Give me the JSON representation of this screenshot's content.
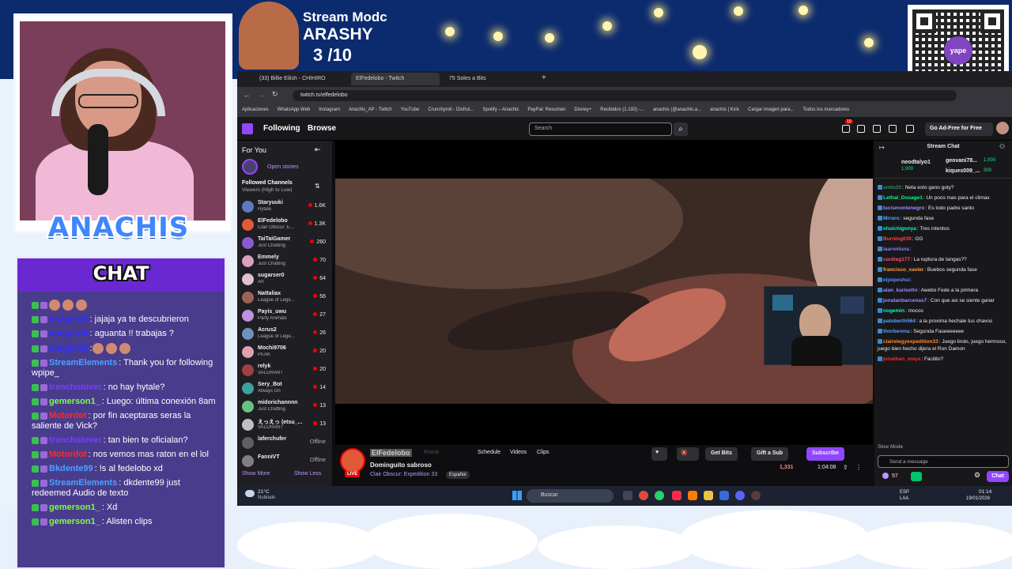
{
  "overlay": {
    "title": "Stream Modc",
    "name": "ARASHY",
    "count": "3  /10",
    "brand": "ANACHIS",
    "chat_header": "CHAT",
    "qr_logo": "yape"
  },
  "overlay_chat": [
    {
      "user": "",
      "text": "",
      "user_color": "#ffffff",
      "emotes": 3
    },
    {
      "user": "dangerdk",
      "text": ": jajaja ya te descubrieron",
      "user_color": "#2e2eff"
    },
    {
      "user": "dangerdk",
      "text": ": aguanta !! trabajas ?",
      "user_color": "#2e2eff"
    },
    {
      "user": "dangerdk",
      "text": ":",
      "user_color": "#2e2eff",
      "emotes": 3
    },
    {
      "user": "StreamElements",
      "text": ": Thank you for following wpipe_",
      "user_color": "#4aa3ff"
    },
    {
      "user": "trencholover",
      "text": ": no hay hytale?",
      "user_color": "#7a3cff"
    },
    {
      "user": "gemerson1_",
      "text": ": Luego: última conexión 8am",
      "user_color": "#7dff4a"
    },
    {
      "user": "Motordot",
      "text": ": por fin aceptaras seras la saliente de Vick?",
      "user_color": "#ff2a2a"
    },
    {
      "user": "trencholover",
      "text": ": tan bien te oficialan?",
      "user_color": "#7a3cff"
    },
    {
      "user": "Motordot",
      "text": ": nos vemos mas raton en el lol",
      "user_color": "#ff2a2a"
    },
    {
      "user": "Bkdente99",
      "text": ": !s al fedelobo xd",
      "user_color": "#4aa3ff"
    },
    {
      "user": "StreamElements",
      "text": ": dkdente99 just redeemed Audio de texto",
      "user_color": "#4aa3ff"
    },
    {
      "user": "gemerson1_",
      "text": ": Xd",
      "user_color": "#7dff4a"
    },
    {
      "user": "gemerson1_",
      "text": ": Alisten clips",
      "user_color": "#7dff4a"
    }
  ],
  "browser": {
    "tabs": [
      {
        "label": "(33) Billie Eilish - CHIHIRO",
        "active": false
      },
      {
        "label": "ElFedelobo - Twitch",
        "active": true
      },
      {
        "label": "75 Soles a Bits",
        "active": false
      }
    ],
    "new_tab": "+",
    "url": "twitch.tv/elfedelobo",
    "bookmarks": [
      "Aplicaciones",
      "WhatsApp Web",
      "Instagram",
      "Anachis_AP - Twitch",
      "YouTube",
      "Crunchyroll - Disfrut...",
      "Spotify – Anachis",
      "PayPal: Resumen",
      "Disney+",
      "Recibidos (1.192) -...",
      "anachis (@anachis.a...",
      "anachis | Kick",
      "Cargar imagen para...",
      "Todos los marcadores"
    ]
  },
  "twitch": {
    "nav_following": "Following",
    "nav_browse": "Browse",
    "search_placeholder": "Search",
    "notif_count": "19",
    "go_ad_free": "Go Ad-Free for Free",
    "sidebar": {
      "for_you": "For You",
      "open_stories": "Open stories",
      "followed_channels": "Followed Channels",
      "sort": "Viewers (High to Low)",
      "show_more": "Show More",
      "show_less": "Show Less",
      "channels": [
        {
          "name": "Staryuuki",
          "game": "Hytale",
          "viewers": "1.6K",
          "color": "#5a7ac0"
        },
        {
          "name": "ElFedelobo",
          "game": "Clair Obscur: E...",
          "viewers": "1.3K",
          "color": "#e05a3a"
        },
        {
          "name": "TaiTaiGamer",
          "game": "Just Chatting",
          "viewers": "260",
          "color": "#8a5acf"
        },
        {
          "name": "Emmely",
          "game": "Just Chatting",
          "viewers": "70",
          "color": "#d9a0c0"
        },
        {
          "name": "sugarser0",
          "game": "Art",
          "viewers": "64",
          "color": "#e0c0d0"
        },
        {
          "name": "Nattaliax",
          "game": "League of Lege...",
          "viewers": "56",
          "color": "#a0605a"
        },
        {
          "name": "Payis_uwu",
          "game": "Party Animals",
          "viewers": "27",
          "color": "#c090e0"
        },
        {
          "name": "Acrus2",
          "game": "League of Lege...",
          "viewers": "26",
          "color": "#7090c0"
        },
        {
          "name": "Mochi9706",
          "game": "PEAK",
          "viewers": "20",
          "color": "#e0a0b0"
        },
        {
          "name": "relyk",
          "game": "VALORANT",
          "viewers": "20",
          "color": "#a04040"
        },
        {
          "name": "Sery_Bot",
          "game": "Always On",
          "viewers": "14",
          "color": "#40a0a0"
        },
        {
          "name": "midorichannnn",
          "game": "Just Chatting",
          "viewers": "13",
          "color": "#6ac080"
        },
        {
          "name": "えっえっ (etsu_...",
          "game": "VALORANT",
          "viewers": "13",
          "color": "#c0c0c0"
        },
        {
          "name": "laferchufer",
          "game": "",
          "viewers": "Offline",
          "color": "#606060"
        },
        {
          "name": "FanniVT",
          "game": "",
          "viewers": "Offline",
          "color": "#808080"
        }
      ]
    },
    "stream": {
      "streamer": "ElFedelobo",
      "live": "LIVE",
      "title": "Dominguito sabroso",
      "game": "Clair Obscur: Expedition 33",
      "language": "Español",
      "schedule": "Schedule",
      "videos": "Videos",
      "clips": "Clips",
      "knock": "Knock",
      "get_bits": "Get Bits",
      "gift_sub": "Gift a Sub",
      "subscribe": "Subscribe",
      "viewers": "1,331",
      "uptime": "1:04:08"
    },
    "chat": {
      "title": "Stream Chat",
      "leaderboard": [
        {
          "name": "neodtalyo1",
          "points": "1,000"
        },
        {
          "name": "geovani78...",
          "points": "1,000"
        },
        {
          "name": "kiques009_...",
          "points": "300"
        }
      ],
      "messages": [
        {
          "user": "antto20",
          "color": "#2e8b57",
          "text": ": Neta esto gano goty?"
        },
        {
          "user": "Lethal_Dosage1",
          "color": "#00ff7f",
          "text": ": Un poco mas para el climax"
        },
        {
          "user": "lucismontenegro",
          "color": "#9b8cff",
          "text": ": Es todo padre santo"
        },
        {
          "user": "Mrraro",
          "color": "#5aa0ff",
          "text": ": segunda fase"
        },
        {
          "user": "shuichigonya",
          "color": "#00ffc8",
          "text": ": Tres intentos"
        },
        {
          "user": "Burning039",
          "color": "#ff4040",
          "text": ": GG"
        },
        {
          "user": "laaronluna",
          "color": "#8a7cff",
          "text": ":"
        },
        {
          "user": "cardieg177",
          "color": "#ff4d6d",
          "text": ": La ruptura de tangas??"
        },
        {
          "user": "francisco_xavier",
          "color": "#ff9c4a",
          "text": ": Buebos segunda fase"
        },
        {
          "user": "elpepeshui",
          "color": "#5a8cff",
          "text": ":"
        },
        {
          "user": "alan_karisefni",
          "color": "#9b8cff",
          "text": ": Awebo Fede a la primera"
        },
        {
          "user": "jonatanbarcenas7",
          "color": "#9b8cff",
          "text": ": Con que asi se siente ganar"
        },
        {
          "user": "nogemin",
          "color": "#00ffc8",
          "text": ": mocos"
        },
        {
          "user": "patoberth564",
          "color": "#5aa0ff",
          "text": ": a la proxima hechale tus chavos"
        },
        {
          "user": "thorbenma",
          "color": "#5aa0ff",
          "text": ": Segunda Faseeeeeee"
        },
        {
          "user": "clairelegyexpedition33",
          "color": "#ff8a2a",
          "text": ": Juego lindo, juego hermoso, juego bien hecho dijera el Ron Damon"
        },
        {
          "user": "jonathan_mays",
          "color": "#ff2a2a",
          "text": ": Facilito?"
        }
      ],
      "slow_mode": "Slow Mode",
      "placeholder": "Send a message",
      "bits": "57",
      "chat_button": "Chat"
    }
  },
  "taskbar": {
    "weather_temp": "21°C",
    "weather_desc": "Nublado",
    "search": "Buscar",
    "lang": "ESP",
    "lang2": "LAA",
    "time": "01:14",
    "date": "19/01/2026"
  },
  "colors": {
    "twitch_purple": "#9147ff",
    "live_red": "#eb0400",
    "overlay_blue": "#0c2a6e"
  }
}
